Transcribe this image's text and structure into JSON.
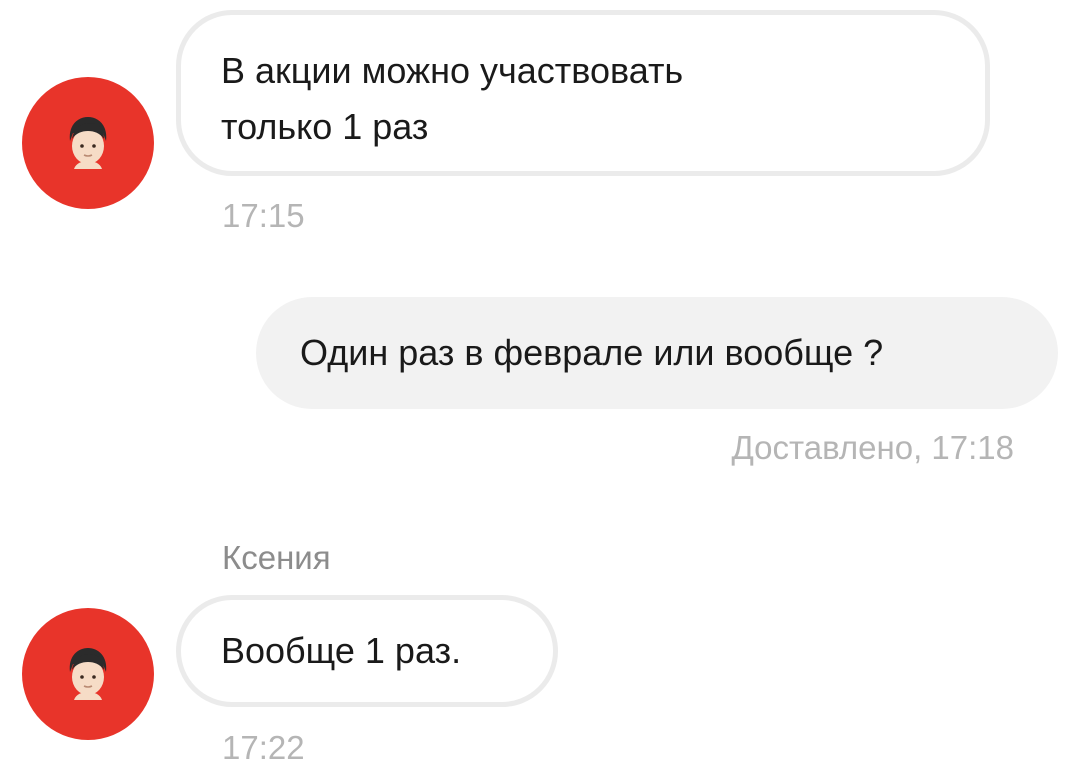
{
  "messages": [
    {
      "direction": "incoming",
      "lines": [
        "В акции можно участвовать",
        "только 1 раз"
      ],
      "time": "17:15"
    },
    {
      "direction": "outgoing",
      "text": "Один раз в феврале или вообще ?",
      "status": "Доставлено, 17:18"
    },
    {
      "direction": "incoming",
      "sender": "Ксения",
      "text": "Вообще 1 раз.",
      "time": "17:22"
    }
  ],
  "avatar": {
    "icon": "person-emoji-icon",
    "background_color": "#e8342a"
  },
  "colors": {
    "incoming_bubble_border": "#ebebeb",
    "outgoing_bubble_bg": "#f2f2f2",
    "meta_text": "#b5b5b5",
    "sender_text": "#8c8c8c"
  }
}
